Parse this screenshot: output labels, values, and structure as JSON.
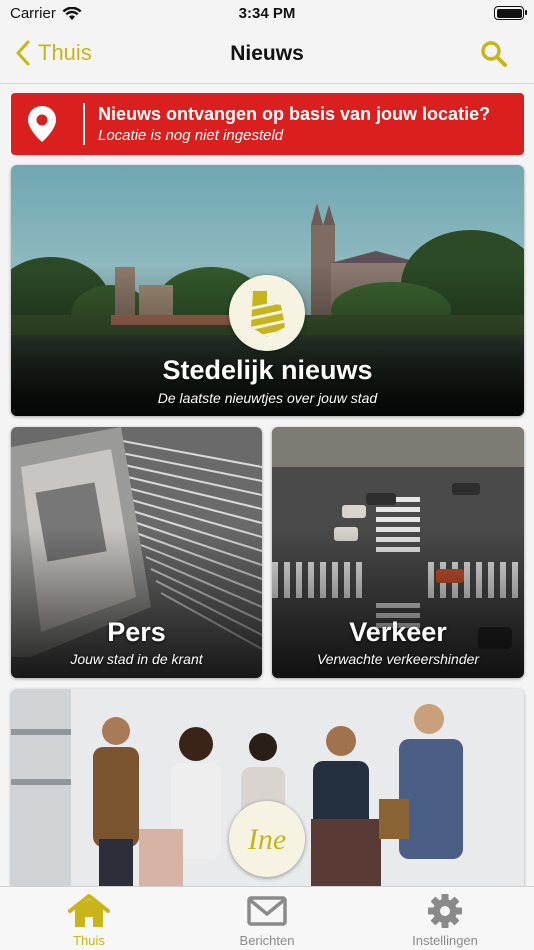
{
  "status": {
    "carrier": "Carrier",
    "time": "3:34 PM"
  },
  "nav": {
    "back_label": "Thuis",
    "title": "Nieuws",
    "accent": "#c8b519",
    "search_icon": "search-icon"
  },
  "banner": {
    "title": "Nieuws ontvangen op basis van jouw locatie?",
    "subtitle": "Locatie is nog niet ingesteld",
    "color": "#d9201f",
    "icon": "location-pin-icon"
  },
  "tiles": [
    {
      "title": "Stedelijk nieuws",
      "subtitle": "De laatste nieuwtjes over jouw stad"
    },
    {
      "title": "Pers",
      "subtitle": "Jouw stad in de krant"
    },
    {
      "title": "Verkeer",
      "subtitle": "Verwachte verkeershinder"
    },
    {
      "logo_text": "Ine"
    }
  ],
  "tabbar": {
    "items": [
      {
        "label": "Thuis",
        "icon": "home-icon",
        "active": true
      },
      {
        "label": "Berichten",
        "icon": "mail-icon",
        "active": false
      },
      {
        "label": "Instellingen",
        "icon": "gear-icon",
        "active": false
      }
    ]
  }
}
